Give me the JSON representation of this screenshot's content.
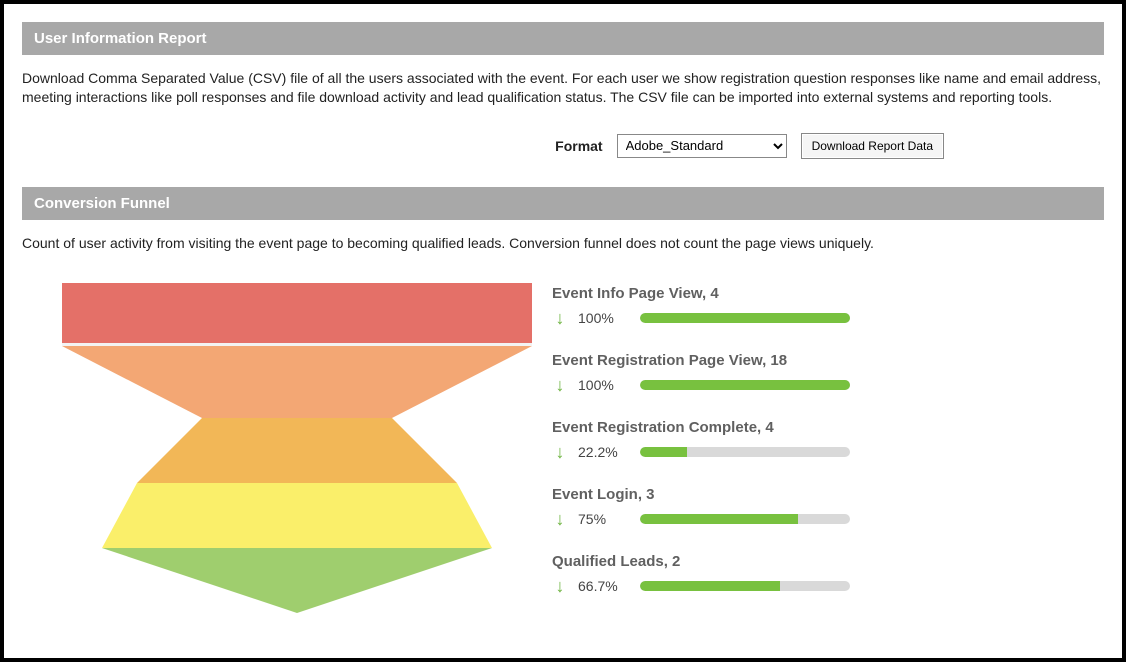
{
  "userInfo": {
    "header": "User Information Report",
    "desc": "Download Comma Separated Value (CSV) file of all the users associated with the event. For each user we show registration question responses like name and email address, meeting interactions like poll responses and file download activity and lead qualification status. The CSV file can be imported into external systems and reporting tools.",
    "formatLabel": "Format",
    "formatSelected": "Adobe_Standard",
    "downloadBtn": "Download Report Data"
  },
  "funnel": {
    "header": "Conversion Funnel",
    "desc": "Count of user activity from visiting the event page to becoming qualified leads. Conversion funnel does not count the page views uniquely."
  },
  "chart_data": {
    "type": "funnel",
    "stages": [
      {
        "label": "Event Info Page View",
        "value": 4,
        "pct": 100,
        "pctText": "100%"
      },
      {
        "label": "Event Registration Page View",
        "value": 18,
        "pct": 100,
        "pctText": "100%"
      },
      {
        "label": "Event Registration Complete",
        "value": 4,
        "pct": 22.2,
        "pctText": "22.2%"
      },
      {
        "label": "Event Login",
        "value": 3,
        "pct": 75,
        "pctText": "75%"
      },
      {
        "label": "Qualified Leads",
        "value": 2,
        "pct": 66.7,
        "pctText": "66.7%"
      }
    ],
    "colors": {
      "stage1": "#e47068",
      "stage2": "#f3a774",
      "stage2b": "#f2b757",
      "stage3": "#faef6a",
      "stage4": "#9fce6e",
      "barFill": "#78c13f",
      "barTrack": "#d9d9d9",
      "arrow": "#6db33f"
    }
  }
}
